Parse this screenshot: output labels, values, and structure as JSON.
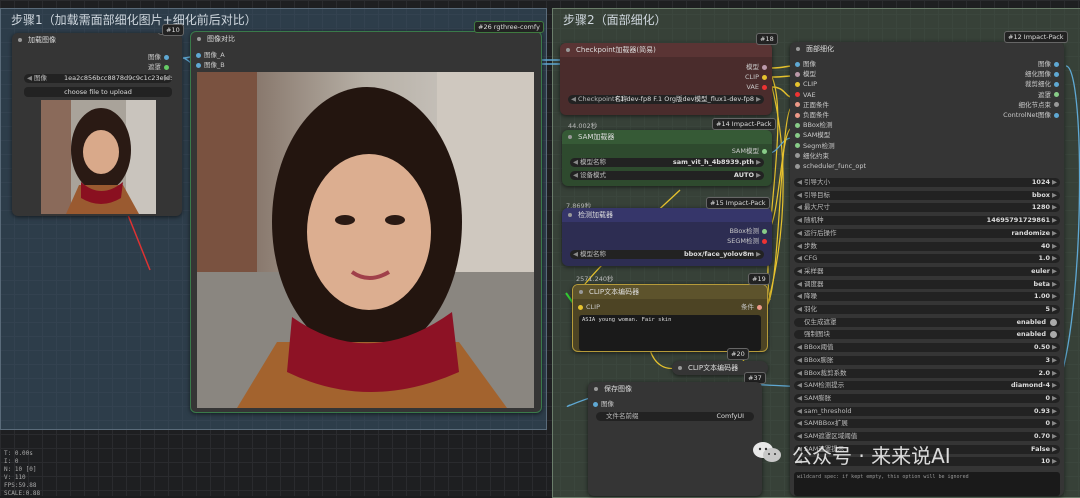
{
  "groups": {
    "step1": "步骤1（加载需面部细化图片+细化前后对比）",
    "step2": "步骤2（面部细化）"
  },
  "load_image": {
    "badge": "#10",
    "title": "加载图像",
    "outputs": [
      "图像",
      "遮罩"
    ],
    "file_label": "图像",
    "file_value": "1ea2c856bcc8878d9c9c1c23efd5d…",
    "upload_button": "choose file to upload"
  },
  "compare": {
    "badge": "#26 rgthree-comfy",
    "title": "图像对比",
    "inputs": [
      "图像_A",
      "图像_B"
    ]
  },
  "checkpoint": {
    "badge": "#18",
    "title": "Checkpoint加载器(简易)",
    "outputs": [
      "模型",
      "CLIP",
      "VAE"
    ],
    "widget_label": "Checkpoint名称",
    "widget_value": "F.1-dev-fp8 F.1 Org版dev模型_flux1-dev-fp8"
  },
  "sam": {
    "timing": "44.002秒",
    "badge": "#14 Impact-Pack",
    "title": "SAM加载器",
    "output": "SAM模型",
    "widgets": [
      {
        "label": "模型名称",
        "value": "sam_vit_h_4b8939.pth"
      },
      {
        "label": "设备模式",
        "value": "AUTO"
      }
    ]
  },
  "detector": {
    "timing": "7.869秒",
    "badge": "#15 Impact-Pack",
    "title": "检测加载器",
    "outputs": [
      "BBox检测",
      "SEGM检测"
    ],
    "widget_label": "模型名称",
    "widget_value": "bbox/face_yolov8m"
  },
  "clip_encode": {
    "timing": "2571.240秒",
    "badge": "#19",
    "title": "CLIP文本编码器",
    "input": "CLIP",
    "output": "条件",
    "text": "ASIA young woman. Fair skin",
    "badge2": "#20"
  },
  "clip_collapsed": {
    "title": "CLIP文本编码器",
    "badge": "#37"
  },
  "save_image": {
    "title": "保存图像",
    "input": "图像",
    "widget_label": "文件名前缀",
    "widget_value": "ComfyUI"
  },
  "face_detail": {
    "badge": "#12 Impact-Pack",
    "title": "面部细化",
    "inputs": [
      "图像",
      "模型",
      "CLIP",
      "VAE",
      "正面条件",
      "负面条件",
      "BBox检测",
      "SAM模型",
      "Segm检测",
      "细化约束",
      "scheduler_func_opt"
    ],
    "outputs": [
      "图像",
      "细化图像",
      "裁剪细化",
      "遮罩",
      "细化节点束",
      "ControlNet图像"
    ],
    "widgets": [
      {
        "label": "引导大小",
        "value": "1024"
      },
      {
        "label": "引导目标",
        "value": "bbox"
      },
      {
        "label": "最大尺寸",
        "value": "1280"
      },
      {
        "label": "随机种",
        "value": "1469579172986​1"
      },
      {
        "label": "运行后操作",
        "value": "randomize"
      },
      {
        "label": "步数",
        "value": "40"
      },
      {
        "label": "CFG",
        "value": "1.0"
      },
      {
        "label": "采样器",
        "value": "euler"
      },
      {
        "label": "调度器",
        "value": "beta"
      },
      {
        "label": "降噪",
        "value": "1.00"
      },
      {
        "label": "羽化",
        "value": "5"
      },
      {
        "label": "仅生成遮罩",
        "value": "enabled",
        "toggle": true
      },
      {
        "label": "强制图块",
        "value": "enabled",
        "toggle": true
      },
      {
        "label": "BBox阈值",
        "value": "0.50"
      },
      {
        "label": "BBox膨胀",
        "value": "3"
      },
      {
        "label": "BBox裁剪系数",
        "value": "2.0"
      },
      {
        "label": "SAM检测提示",
        "value": "diamond-4"
      },
      {
        "label": "SAM膨胀",
        "value": "0"
      },
      {
        "label": "sam_threshold",
        "value": "0.93"
      },
      {
        "label": "SAMBBox扩展",
        "value": "0"
      },
      {
        "label": "SAM遮罩区域阈值",
        "value": "0.70"
      },
      {
        "label": "SAM遮罩提示",
        "value": "False"
      },
      {
        "label": "",
        "value": "10"
      }
    ],
    "footer_text": "wildcard spec: if kept empty, this option will be ignored"
  },
  "stats": [
    "T: 0.00s",
    "I: 0",
    "N: 10 [0]",
    "V: 110",
    "FPS:59.88",
    "SCALE:0.88"
  ],
  "watermark": "公众号 · 来来说AI",
  "colors": {
    "checkpoint_bg": "#4a2c2c",
    "sam_bg": "#2e4a2e",
    "detector_bg": "#2d2d52",
    "clip_bg": "#4d4424",
    "wire_yellow": "#e6c22e",
    "wire_blue": "#5fa8d3",
    "wire_red": "#d33"
  }
}
